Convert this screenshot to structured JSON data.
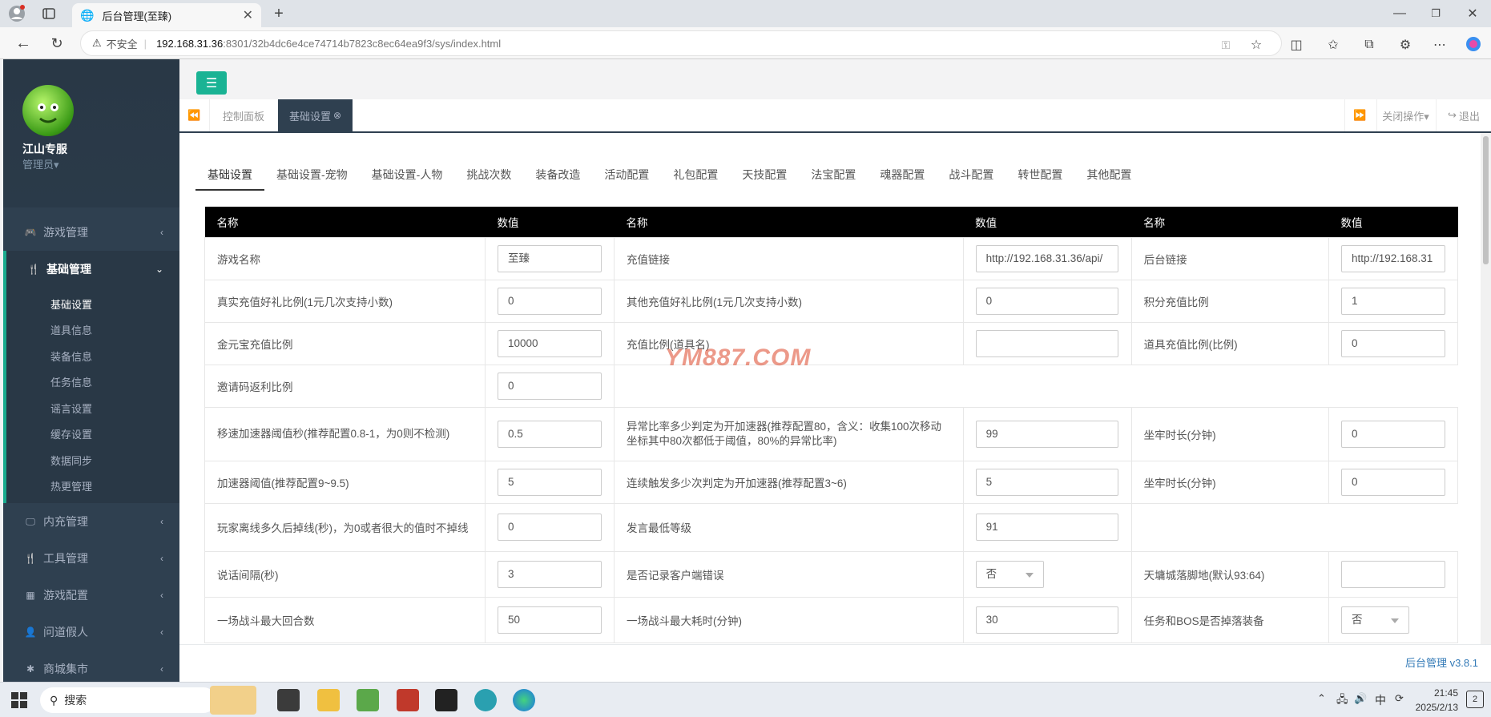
{
  "browser": {
    "tab_title": "后台管理(至臻)",
    "security_label": "不安全",
    "url_host": "192.168.31.36",
    "url_rest": ":8301/32b4dc6e4ce74714b7823c8ec64ea9f3/sys/index.html"
  },
  "sidebar": {
    "user_name": "江山专服",
    "role": "管理员▾",
    "menus": [
      {
        "label": "游戏管理",
        "icon": "gamepad-icon"
      },
      {
        "label": "基础管理",
        "icon": "cutlery-icon",
        "active": true
      },
      {
        "label": "内充管理",
        "icon": "monitor-icon"
      },
      {
        "label": "工具管理",
        "icon": "cutlery-icon"
      },
      {
        "label": "游戏配置",
        "icon": "grid-icon"
      },
      {
        "label": "问道假人",
        "icon": "user-icon"
      },
      {
        "label": "商城集市",
        "icon": "gear-icon"
      }
    ],
    "submenu": [
      "基础设置",
      "道具信息",
      "装备信息",
      "任务信息",
      "谣言设置",
      "缓存设置",
      "数据同步",
      "热更管理"
    ]
  },
  "tabstrip": {
    "dashboard": "控制面板",
    "current": "基础设置",
    "close_ops": "关闭操作▾",
    "logout": "退出"
  },
  "subtabs": [
    "基础设置",
    "基础设置-宠物",
    "基础设置-人物",
    "挑战次数",
    "装备改造",
    "活动配置",
    "礼包配置",
    "天技配置",
    "法宝配置",
    "魂器配置",
    "战斗配置",
    "转世配置",
    "其他配置"
  ],
  "table": {
    "headers": [
      "名称",
      "数值",
      "名称",
      "数值",
      "名称",
      "数值"
    ],
    "rows": [
      [
        "游戏名称",
        "至臻",
        "充值链接",
        "http://192.168.31.36/api/",
        "后台链接",
        "http://192.168.31"
      ],
      [
        "真实充值好礼比例(1元几次支持小数)",
        "0",
        "其他充值好礼比例(1元几次支持小数)",
        "0",
        "积分充值比例",
        "1"
      ],
      [
        "金元宝充值比例",
        "10000",
        "充值比例(道具名)",
        "",
        "道具充值比例(比例)",
        "0"
      ],
      [
        "邀请码返利比例",
        "0",
        "",
        null,
        "",
        null
      ],
      [
        "移速加速器阈值秒(推荐配置0.8-1，为0则不检测)",
        "0.5",
        "异常比率多少判定为开加速器(推荐配置80，含义：收集100次移动坐标其中80次都低于阈值，80%的异常比率)",
        "99",
        "坐牢时长(分钟)",
        "0"
      ],
      [
        "加速器阈值(推荐配置9~9.5)",
        "5",
        "连续触发多少次判定为开加速器(推荐配置3~6)",
        "5",
        "坐牢时长(分钟)",
        "0"
      ],
      [
        "玩家离线多久后掉线(秒)，为0或者很大的值时不掉线",
        "0",
        "发言最低等级",
        "91",
        "",
        null
      ],
      [
        "说话间隔(秒)",
        "3",
        "是否记录客户端错误",
        "否",
        "天墉城落脚地(默认93:64)",
        ""
      ],
      [
        "一场战斗最大回合数",
        "50",
        "一场战斗最大耗时(分钟)",
        "30",
        "任务和BOS是否掉落装备",
        "否"
      ]
    ]
  },
  "watermark": "YM887.COM",
  "footer": "后台管理 v3.8.1",
  "taskbar": {
    "search": "搜索",
    "ime": "中",
    "time": "21:45",
    "date": "2025/2/13",
    "notif": "2"
  }
}
